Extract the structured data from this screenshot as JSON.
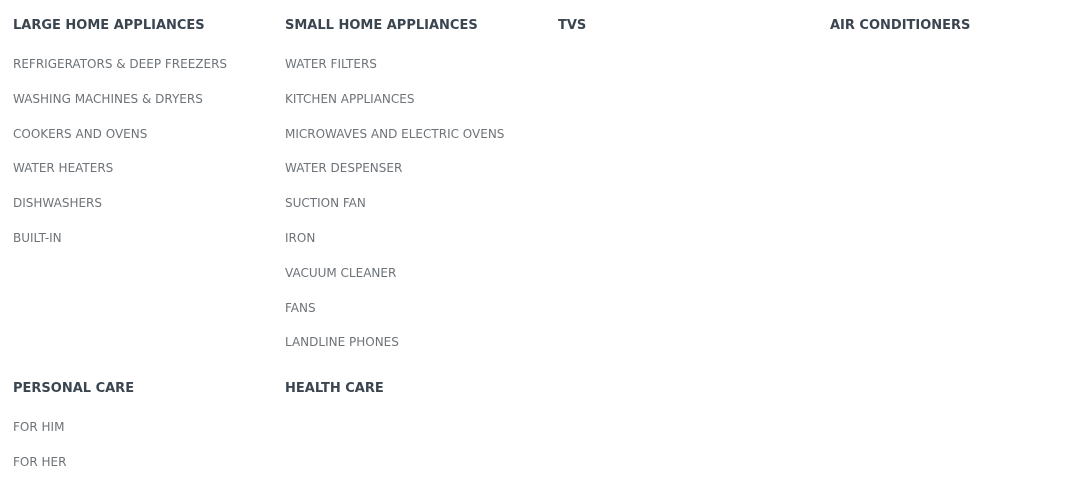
{
  "menu": {
    "large_home_appliances": {
      "title": "LARGE HOME APPLIANCES",
      "items": [
        "REFRIGERATORS & DEEP FREEZERS",
        "WASHING MACHINES & DRYERS",
        "COOKERS AND OVENS",
        "WATER HEATERS",
        "DISHWASHERS",
        "BUILT-IN"
      ]
    },
    "small_home_appliances": {
      "title": "SMALL HOME APPLIANCES",
      "items": [
        "WATER FILTERS",
        "KITCHEN APPLIANCES",
        "MICROWAVES AND ELECTRIC OVENS",
        "WATER DESPENSER",
        "SUCTION FAN",
        "IRON",
        "VACUUM CLEANER",
        "FANS",
        "LANDLINE PHONES"
      ]
    },
    "tvs": {
      "title": "TVS"
    },
    "air_conditioners": {
      "title": "AIR CONDITIONERS"
    },
    "personal_care": {
      "title": "PERSONAL CARE",
      "items": [
        "FOR HIM",
        "FOR HER"
      ]
    },
    "health_care": {
      "title": "HEALTH CARE"
    }
  },
  "colors": {
    "heading": "#3a4550",
    "item": "#6d7378",
    "background": "#ffffff"
  }
}
